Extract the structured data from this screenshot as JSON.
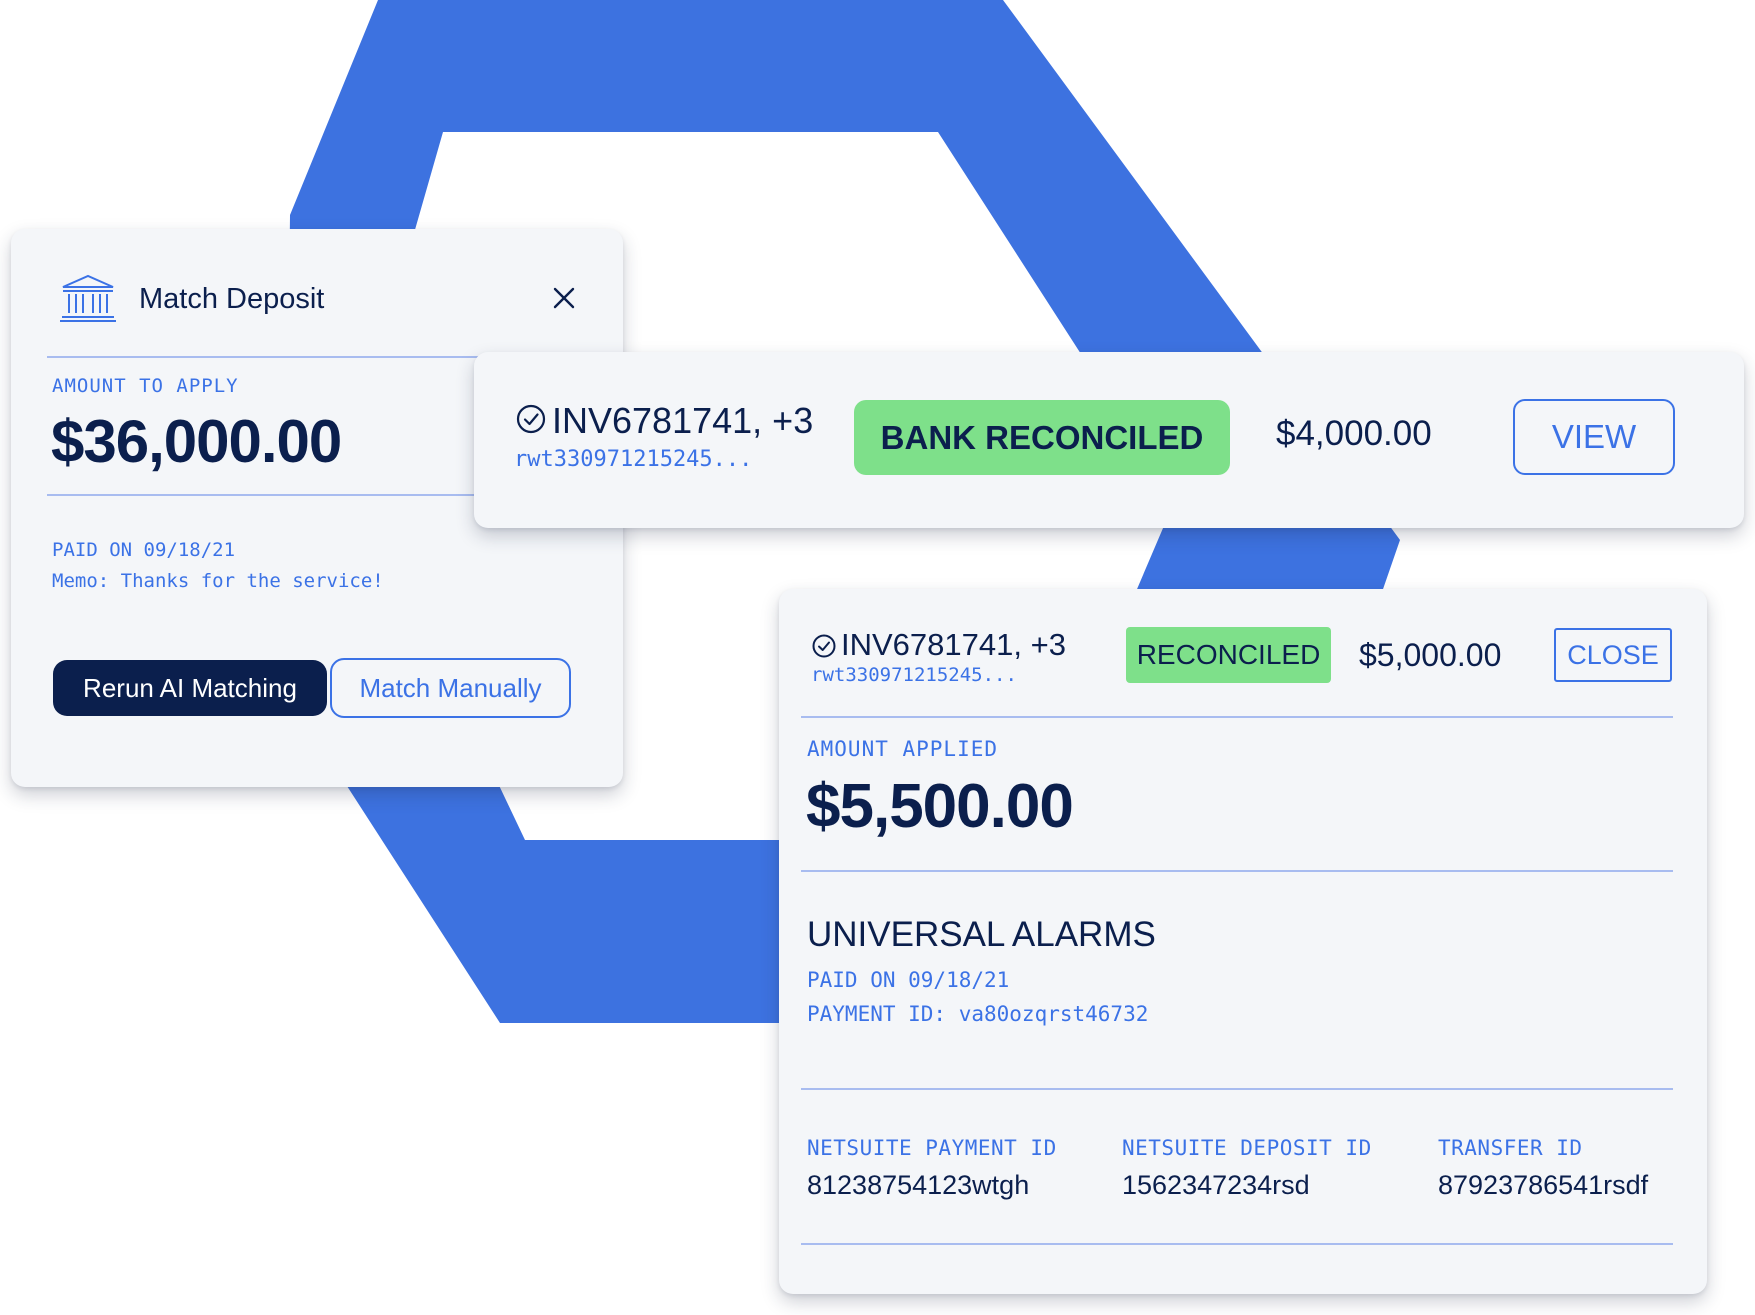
{
  "colors": {
    "navy": "#0b1f4d",
    "accent_blue": "#3b72e6",
    "success_green": "#7ee08a",
    "card_bg": "#f4f6f9",
    "background_hex": "#3d72e0"
  },
  "match_deposit": {
    "icon": "bank-icon",
    "title": "Match Deposit",
    "close_icon": "close-icon",
    "amount_label": "AMOUNT TO APPLY",
    "amount": "$36,000.00",
    "paid_on": "PAID ON 09/18/21",
    "memo": "Memo: Thanks for the service!",
    "primary_button": "Rerun AI Matching",
    "secondary_button": "Match Manually"
  },
  "bank_row": {
    "invoice": "INV6781741, +3",
    "reference": "rwt330971215245...",
    "status": "BANK RECONCILED",
    "amount": "$4,000.00",
    "action": "VIEW"
  },
  "detail": {
    "invoice": "INV6781741, +3",
    "reference": "rwt330971215245...",
    "status": "RECONCILED",
    "amount": "$5,000.00",
    "action": "CLOSE",
    "amount_label": "AMOUNT APPLIED",
    "amount_applied": "$5,500.00",
    "payer": "UNIVERSAL ALARMS",
    "paid_on": "PAID ON 09/18/21",
    "payment_id": "PAYMENT ID: va80ozqrst46732",
    "ids": [
      {
        "label": "NETSUITE PAYMENT ID",
        "value": "81238754123wtgh"
      },
      {
        "label": "NETSUITE DEPOSIT ID",
        "value": "1562347234rsd"
      },
      {
        "label": "TRANSFER ID",
        "value": "87923786541rsdf"
      }
    ]
  }
}
